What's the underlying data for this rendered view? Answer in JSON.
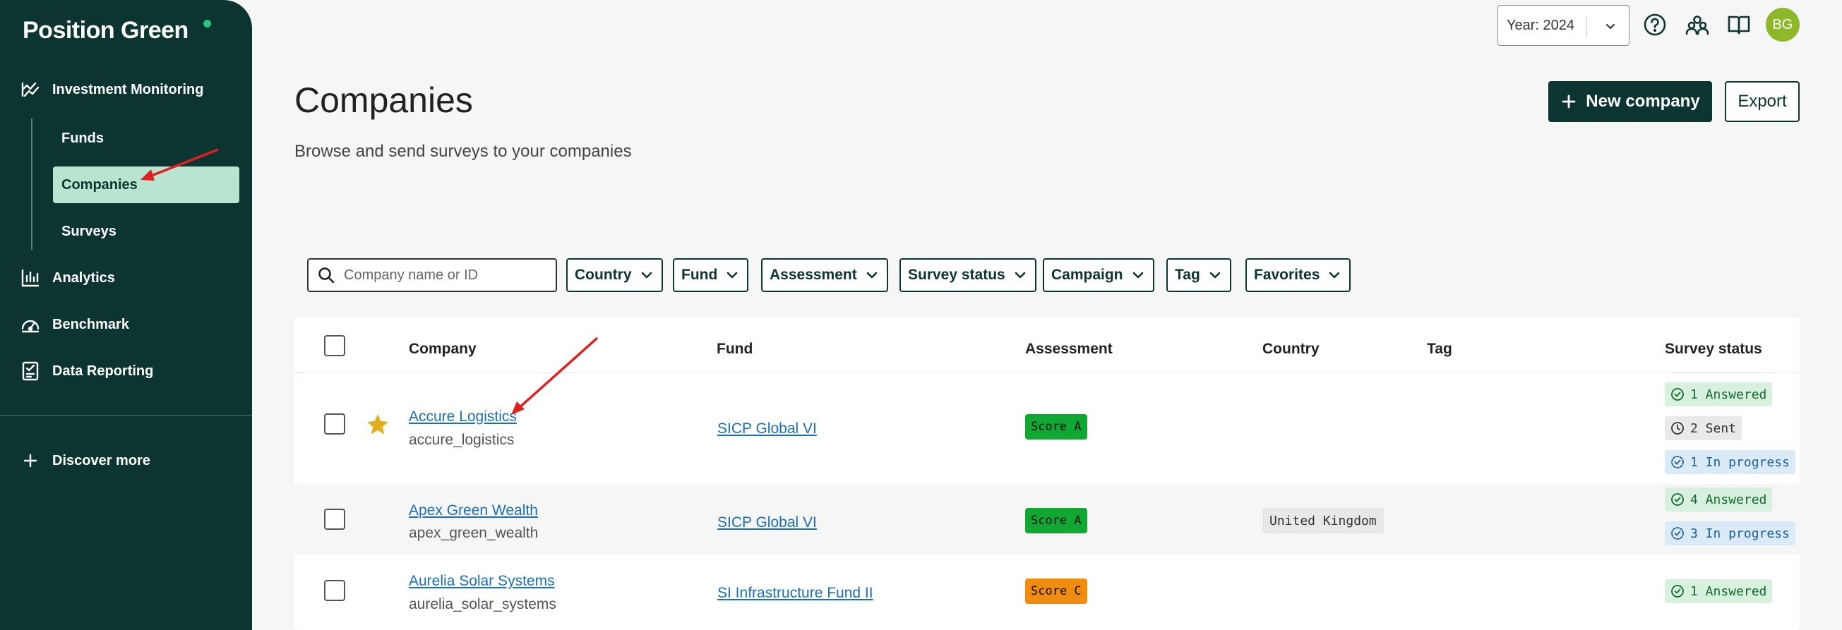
{
  "sidebar": {
    "logo": "Position Green",
    "sections": {
      "investment_monitoring": "Investment Monitoring",
      "analytics": "Analytics",
      "benchmark": "Benchmark",
      "data_reporting": "Data Reporting",
      "discover_more": "Discover more"
    },
    "sub_items": [
      "Funds",
      "Companies",
      "Surveys"
    ],
    "active_item": "Companies"
  },
  "topbar": {
    "year_label": "Year: 2024",
    "avatar_initials": "BG",
    "icons": [
      "help-circle-icon",
      "community-icon",
      "book-icon"
    ]
  },
  "header": {
    "title": "Companies",
    "subtitle": "Browse and send surveys to your companies",
    "new_company_label": "New company",
    "export_label": "Export"
  },
  "filters": {
    "search_placeholder": "Company name or ID",
    "items": [
      "Country",
      "Fund",
      "Assessment",
      "Survey status",
      "Campaign",
      "Tag",
      "Favorites"
    ]
  },
  "table": {
    "columns": {
      "company": "Company",
      "fund": "Fund",
      "assessment": "Assessment",
      "country": "Country",
      "tag": "Tag",
      "survey_status": "Survey status"
    },
    "rows": [
      {
        "name": "Accure Logistics",
        "id": "accure_logistics",
        "favorite": true,
        "fund": "SICP Global VI",
        "assessment": "Score A",
        "country": "",
        "tag": "",
        "statuses": {
          "answered": "1 Answered",
          "sent": "2 Sent",
          "in_progress": "1 In progress"
        }
      },
      {
        "name": "Apex Green Wealth",
        "id": "apex_green_wealth",
        "favorite": false,
        "fund": "SICP Global VI",
        "assessment": "Score A",
        "country": "United Kingdom",
        "tag": "",
        "statuses": {
          "answered": "4 Answered",
          "in_progress": "3 In progress"
        }
      },
      {
        "name": "Aurelia Solar Systems",
        "id": "aurelia_solar_systems",
        "favorite": false,
        "fund": "SI Infrastructure Fund II",
        "assessment": "Score C",
        "country": "",
        "tag": "",
        "statuses": {
          "answered": "1 Answered"
        }
      }
    ]
  },
  "colors": {
    "sidebar_bg": "#0c3531",
    "active_nav_bg": "#b9e4d0",
    "score_a": "#10a832",
    "score_c": "#f08c10",
    "link": "#1a6fb7",
    "annotation_arrow": "#e02020"
  }
}
